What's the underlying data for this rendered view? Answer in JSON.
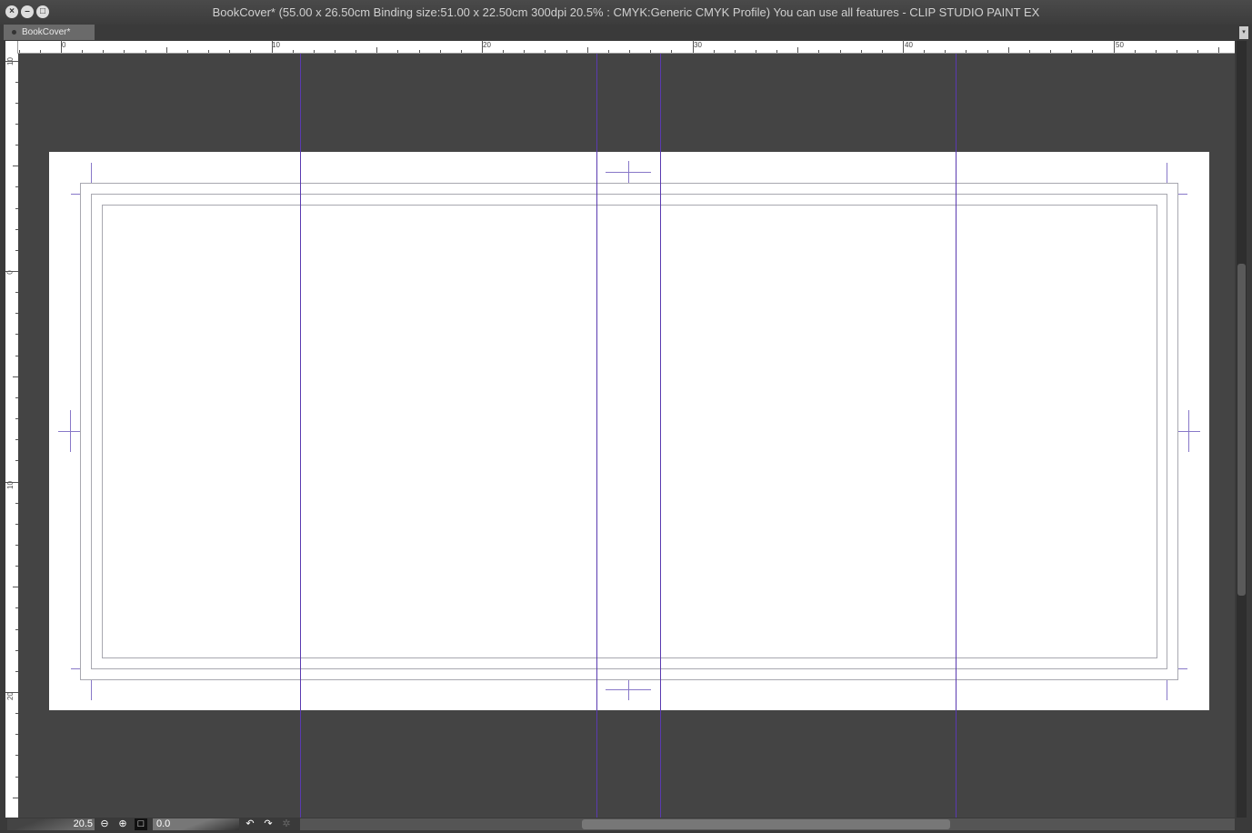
{
  "window": {
    "title": "BookCover* (55.00 x 26.50cm Binding size:51.00 x 22.50cm 300dpi 20.5% : CMYK:Generic CMYK Profile)  You can use all features - CLIP STUDIO PAINT EX"
  },
  "tabs": [
    {
      "label": "BookCover*"
    }
  ],
  "rulers": {
    "horizontal": [
      "0",
      "10",
      "20",
      "30",
      "40",
      "50"
    ],
    "vertical": [
      "10",
      "0",
      "10",
      "20"
    ]
  },
  "status": {
    "zoom": "20.5",
    "rotation": "0.0"
  },
  "icons": {
    "close": "close-icon",
    "minimize": "minimize-icon",
    "maximize": "maximize-icon",
    "zoom_out": "zoom-out-icon",
    "zoom_in": "zoom-in-icon",
    "fit": "fit-icon",
    "undo": "rotate-left-icon",
    "redo": "rotate-right-icon",
    "reset": "reset-rotation-icon"
  },
  "colors": {
    "guide": "#5a3ab0",
    "canvas_bg": "#444444"
  }
}
